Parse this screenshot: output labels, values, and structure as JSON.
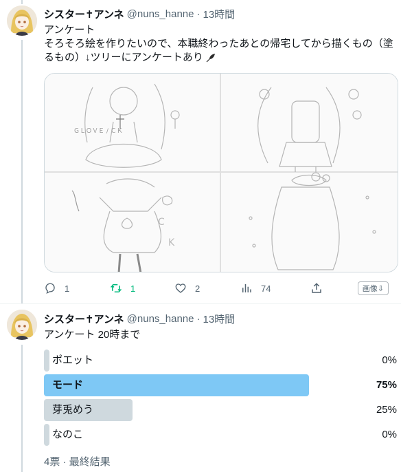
{
  "colors": {
    "accent_bar": "#7ec8f5",
    "bar": "#cfd9de",
    "retweet_green": "#00ba7c",
    "secondary_text": "#536471"
  },
  "tweet1": {
    "name": "シスター✝アンネ",
    "handle": "@nuns_hanne",
    "dot": "·",
    "time": "13時間",
    "text_line1": "アンケート",
    "text_line2": "そろそろ絵を作りたいので、本職終わったあとの帰宅してから描くもの（塗",
    "text_line3": "るもの）↓ツリーにアンケートあり",
    "text_emoji": "feather-icon",
    "media_alt_text": "ＧＬＯＶＥ / ＣＫ",
    "actions": {
      "reply_icon": "reply-icon",
      "reply_count": "1",
      "retweet_icon": "retweet-icon",
      "retweet_count": "1",
      "like_icon": "heart-icon",
      "like_count": "2",
      "views_icon": "views-icon",
      "views_count": "74",
      "share_icon": "share-icon",
      "image_button": "画像⇩"
    }
  },
  "tweet2": {
    "name": "シスター✝アンネ",
    "handle": "@nuns_hanne",
    "dot": "·",
    "time": "13時間",
    "text": "アンケート 20時まで",
    "poll": {
      "options": [
        {
          "label": "ポエット",
          "percent": "0%",
          "fraction": 0.0
        },
        {
          "label": "モード",
          "percent": "75%",
          "fraction": 0.75,
          "winner": true
        },
        {
          "label": "芽兎めう",
          "percent": "25%",
          "fraction": 0.25
        },
        {
          "label": "なのこ",
          "percent": "0%",
          "fraction": 0.0
        }
      ],
      "footer": "4票 · 最終結果"
    }
  }
}
